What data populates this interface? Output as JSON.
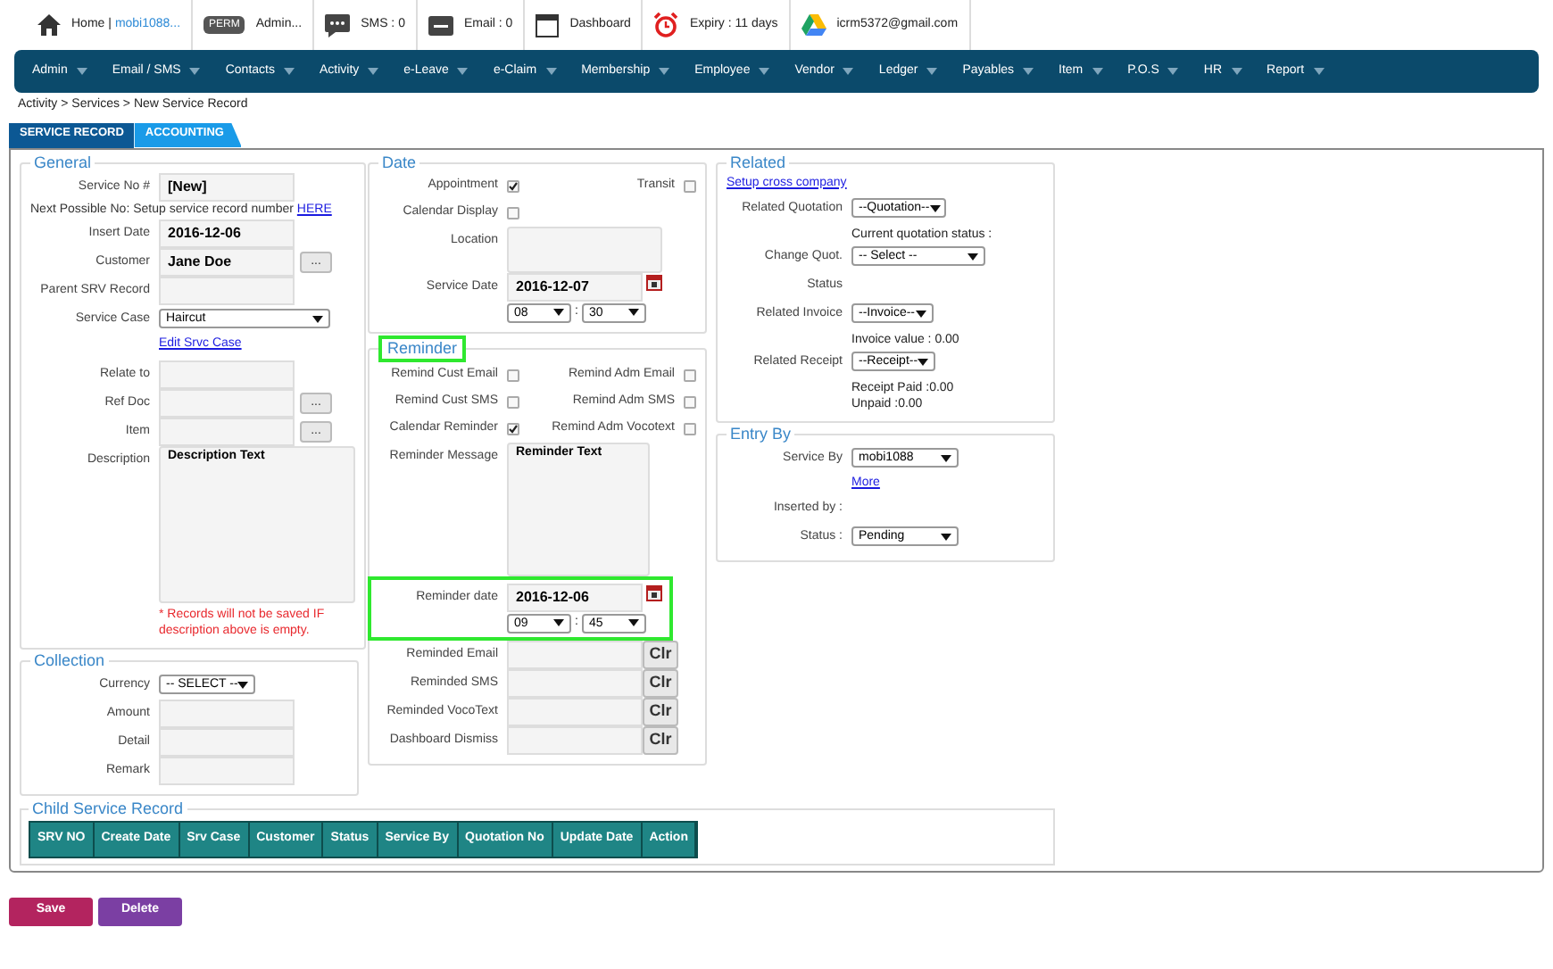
{
  "topbar": [
    {
      "kind": "home",
      "text": "Home |",
      "link": "mobi1088..."
    },
    {
      "kind": "perm",
      "badge": "PERM",
      "text": "Admin..."
    },
    {
      "kind": "sms",
      "text": "SMS : 0"
    },
    {
      "kind": "email",
      "text": "Email : 0"
    },
    {
      "kind": "calendar",
      "text": "Dashboard"
    },
    {
      "kind": "alarm",
      "text": "Expiry : 11 days"
    },
    {
      "kind": "drive",
      "text": "icrm5372@gmail.com"
    }
  ],
  "nav": [
    "Admin",
    "Email / SMS",
    "Contacts",
    "Activity",
    "e-Leave",
    "e-Claim",
    "Membership",
    "Employee",
    "Vendor",
    "Ledger",
    "Payables",
    "Item",
    "P.O.S",
    "HR",
    "Report"
  ],
  "breadcrumb": "Activity > Services > New Service Record",
  "tabs": [
    {
      "label": "SERVICE RECORD",
      "selected": true
    },
    {
      "label": "ACCOUNTING",
      "selected": false
    }
  ],
  "columns": [
    [
      {
        "title": "General",
        "highlighted": false,
        "rows": [
          {
            "kind": "input",
            "label": "Service No #",
            "value": "[New]"
          },
          {
            "kind": "note",
            "text": "Next Possible No: Setup service record number",
            "link": "HERE"
          },
          {
            "kind": "input",
            "label": "Insert Date",
            "value": "2016-12-06"
          },
          {
            "kind": "lookup",
            "label": "Customer",
            "value": "Jane Doe",
            "button": "..."
          },
          {
            "kind": "input",
            "label": "Parent SRV Record"
          },
          {
            "kind": "select",
            "label": "Service Case",
            "value": "Haircut"
          },
          {
            "kind": "link",
            "text": "Edit Srvc Case"
          },
          {
            "kind": "gap"
          },
          {
            "kind": "input",
            "label": "Relate to"
          },
          {
            "kind": "lookup",
            "label": "Ref Doc",
            "button": "..."
          },
          {
            "kind": "lookup",
            "label": "Item",
            "button": "..."
          },
          {
            "kind": "textarea",
            "label": "Description",
            "value": "Description Text",
            "warning": "* Records will not be saved IF description above is empty."
          }
        ]
      },
      {
        "title": "Collection",
        "highlighted": false,
        "rows": [
          {
            "kind": "select",
            "label": "Currency",
            "value": "-- SELECT --"
          },
          {
            "kind": "input",
            "label": "Amount"
          },
          {
            "kind": "input",
            "label": "Detail"
          },
          {
            "kind": "input",
            "label": "Remark"
          }
        ]
      }
    ],
    [
      {
        "title": "Date",
        "highlighted": false,
        "rows": [
          {
            "kind": "checks",
            "items": [
              {
                "label": "Appointment",
                "checked": true
              },
              {
                "label": "Transit",
                "checked": false
              }
            ]
          },
          {
            "kind": "checks",
            "items": [
              {
                "label": "Calendar Display",
                "checked": false
              }
            ]
          },
          {
            "kind": "textarea",
            "label": "Location"
          },
          {
            "kind": "date",
            "label": "Service Date",
            "value": "2016-12-07",
            "hour": "08",
            "separator": ":",
            "minute": "30",
            "highlighted": false
          }
        ]
      },
      {
        "title": "Reminder",
        "highlighted": true,
        "rows": [
          {
            "kind": "checks",
            "items": [
              {
                "label": "Remind Cust Email",
                "checked": false
              },
              {
                "label": "Remind Adm Email",
                "checked": false
              }
            ]
          },
          {
            "kind": "checks",
            "items": [
              {
                "label": "Remind Cust SMS",
                "checked": false
              },
              {
                "label": "Remind Adm SMS",
                "checked": false
              }
            ]
          },
          {
            "kind": "checks",
            "items": [
              {
                "label": "Calendar Reminder",
                "checked": true
              },
              {
                "label": "Remind Adm Vocotext",
                "checked": false
              }
            ]
          },
          {
            "kind": "textarea",
            "label": "Reminder Message",
            "value": "Reminder Text"
          },
          {
            "kind": "date",
            "label": "Reminder date",
            "value": "2016-12-06",
            "hour": "09",
            "separator": ":",
            "minute": "45",
            "highlighted": true
          },
          {
            "kind": "clear",
            "label": "Reminded Email",
            "button": "Clr"
          },
          {
            "kind": "clear",
            "label": "Reminded SMS",
            "button": "Clr"
          },
          {
            "kind": "clear",
            "label": "Reminded VocoText",
            "button": "Clr"
          },
          {
            "kind": "clear",
            "label": "Dashboard Dismiss",
            "button": "Clr"
          }
        ]
      }
    ],
    [
      {
        "title": "Related",
        "highlighted": false,
        "rows": [
          {
            "kind": "link",
            "text": "Setup cross company"
          },
          {
            "kind": "select",
            "label": "Related Quotation",
            "value": "--Quotation--",
            "notes": [
              "Current quotation status :"
            ]
          },
          {
            "kind": "select",
            "label": "Change Quot.",
            "value": "-- Select --"
          },
          {
            "kind": "label",
            "label": "Status"
          },
          {
            "kind": "select",
            "label": "Related Invoice",
            "value": "--Invoice--",
            "notes": [
              "Invoice value : 0.00"
            ]
          },
          {
            "kind": "select",
            "label": "Related Receipt",
            "value": "--Receipt--",
            "notes": [
              "Receipt Paid :0.00",
              "Unpaid :0.00"
            ]
          }
        ]
      },
      {
        "title": "Entry By",
        "highlighted": false,
        "rows": [
          {
            "kind": "select",
            "label": "Service By",
            "value": "mobi1088"
          },
          {
            "kind": "link",
            "text": "More"
          },
          {
            "kind": "label",
            "label": "Inserted by :"
          },
          {
            "kind": "select",
            "label": "Status :",
            "value": "Pending"
          }
        ]
      }
    ]
  ],
  "child_record": {
    "title": "Child Service Record",
    "columns": [
      "SRV NO",
      "Create Date",
      "Srv Case",
      "Customer",
      "Status",
      "Service By",
      "Quotation No",
      "Update Date",
      "Action"
    ]
  },
  "buttons": [
    {
      "label": "Save",
      "kind": "save"
    },
    {
      "label": "Delete",
      "kind": "delete"
    }
  ]
}
